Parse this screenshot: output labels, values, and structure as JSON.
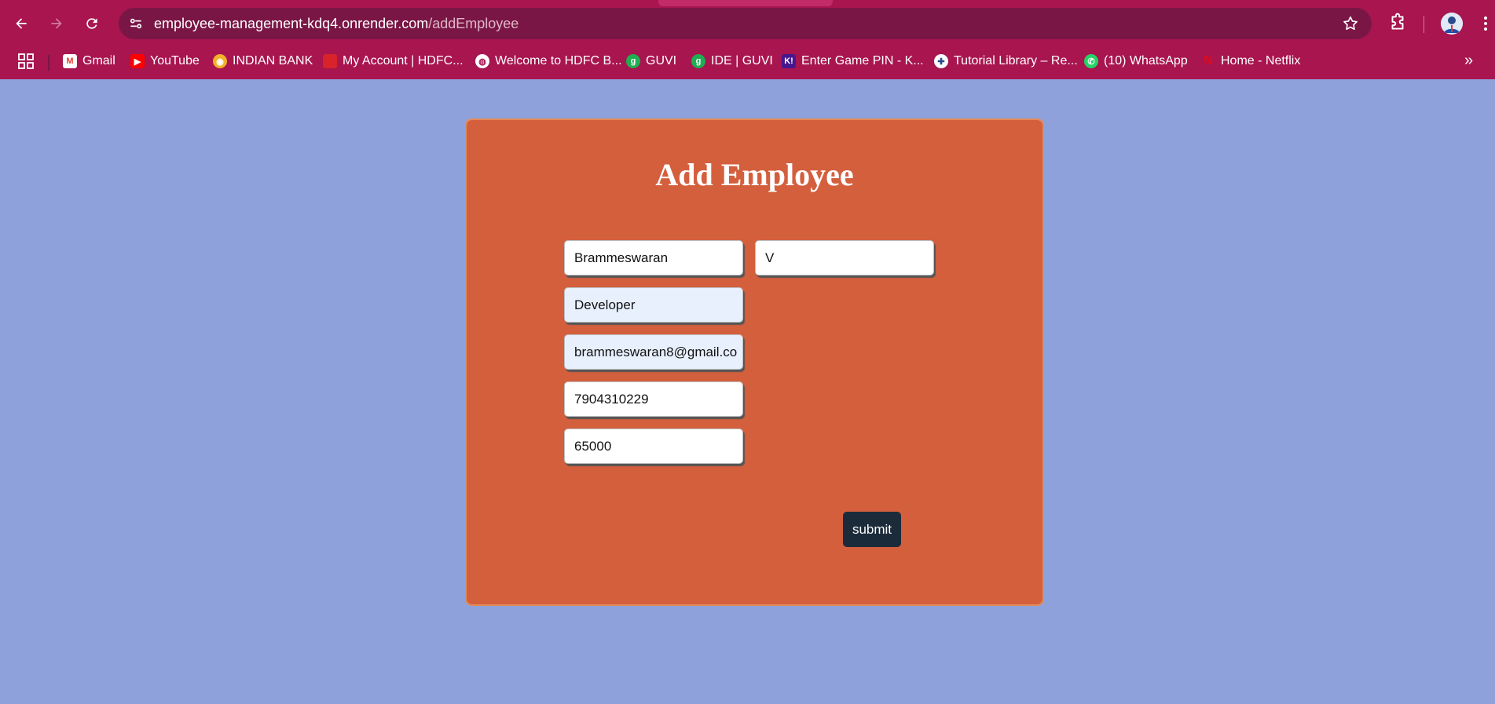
{
  "browser": {
    "url_host": "employee-management-kdq4.onrender.com",
    "url_path": "/addEmployee",
    "bookmarks": [
      {
        "label": "Gmail",
        "icon": "gmail-icon",
        "color": "#ea4335"
      },
      {
        "label": "YouTube",
        "icon": "youtube-icon",
        "color": "#ff0000"
      },
      {
        "label": "INDIAN BANK",
        "icon": "indian-bank-icon",
        "color": "#f2b12b"
      },
      {
        "label": "My Account | HDFC...",
        "icon": "hdfc-icon",
        "color": "#d8232a"
      },
      {
        "label": "Welcome to HDFC B...",
        "icon": "globe-icon",
        "color": "#ffffff"
      },
      {
        "label": "GUVI",
        "icon": "guvi-icon",
        "color": "#1fae51"
      },
      {
        "label": "IDE | GUVI",
        "icon": "guvi-icon",
        "color": "#1fae51"
      },
      {
        "label": "Enter Game PIN - K...",
        "icon": "kahoot-icon",
        "color": "#46178f"
      },
      {
        "label": "Tutorial Library – Re...",
        "icon": "python-icon",
        "color": "#ffffff"
      },
      {
        "label": "(10) WhatsApp",
        "icon": "whatsapp-icon",
        "color": "#25d366"
      },
      {
        "label": "Home - Netflix",
        "icon": "netflix-icon",
        "color": "#e50914"
      }
    ]
  },
  "form": {
    "title": "Add Employee",
    "first_name": "Brammeswaran",
    "last_name": "V",
    "role": "Developer",
    "email": "brammeswaran8@gmail.co",
    "phone": "7904310229",
    "salary": "65000",
    "submit_label": "submit"
  }
}
